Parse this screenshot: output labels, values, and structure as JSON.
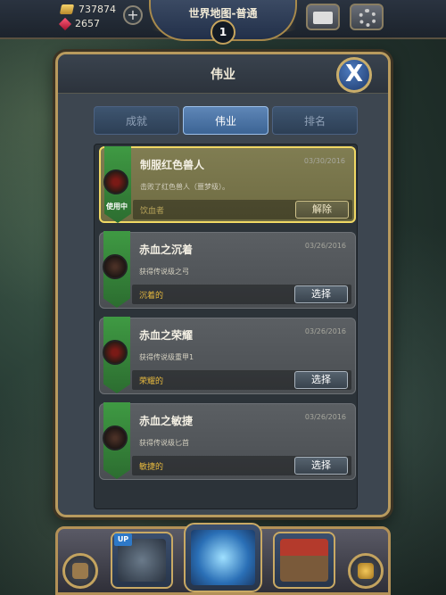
{
  "resources": {
    "gold": "737874",
    "gems": "2657",
    "add_label": "+"
  },
  "header": {
    "title": "世界地图-普通",
    "level": "1"
  },
  "panel": {
    "title": "伟业",
    "close_label": "X",
    "tabs": [
      {
        "label": "成就",
        "active": false
      },
      {
        "label": "伟业",
        "active": true
      },
      {
        "label": "排名",
        "active": false
      }
    ]
  },
  "feats": [
    {
      "name": "制服红色兽人",
      "date": "03/30/2016",
      "desc": "击败了红色兽人（噩梦级）。",
      "title": "饮血者",
      "button": "解除",
      "in_use": true,
      "badge": "使用中"
    },
    {
      "name": "赤血之沉着",
      "date": "03/26/2016",
      "desc": "获得传说级之弓",
      "title": "沉着的",
      "button": "选择",
      "in_use": false
    },
    {
      "name": "赤血之荣耀",
      "date": "03/26/2016",
      "desc": "获得传说级重甲1",
      "title": "荣耀的",
      "button": "选择",
      "in_use": false
    },
    {
      "name": "赤血之敏捷",
      "date": "03/26/2016",
      "desc": "获得传说级匕首",
      "title": "敏捷的",
      "button": "选择",
      "in_use": false
    }
  ],
  "bottom_nav": {
    "up_badge": "UP"
  },
  "colors": {
    "ribbon": "#3f9a43",
    "frame_gold": "#b89a5e",
    "title_gold": "#e6b93e",
    "active_tab": "#5e86b7"
  }
}
